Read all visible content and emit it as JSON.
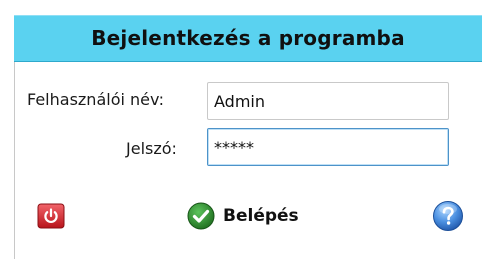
{
  "dialog": {
    "title": "Bejelentkezés a programba"
  },
  "form": {
    "username_label": "Felhasználói név:",
    "username_value": "Admin",
    "password_label": "Jelszó:",
    "password_value": "*****"
  },
  "actions": {
    "login_label": "Belépés",
    "exit_icon": "power-icon",
    "login_icon": "checkmark-icon",
    "help_icon": "question-icon"
  },
  "colors": {
    "title_bar": "#5ad2f0",
    "exit_red": "#d9252b",
    "login_green": "#2e8f2e",
    "help_blue": "#3b7fd4",
    "focus_border": "#4d93c9"
  }
}
